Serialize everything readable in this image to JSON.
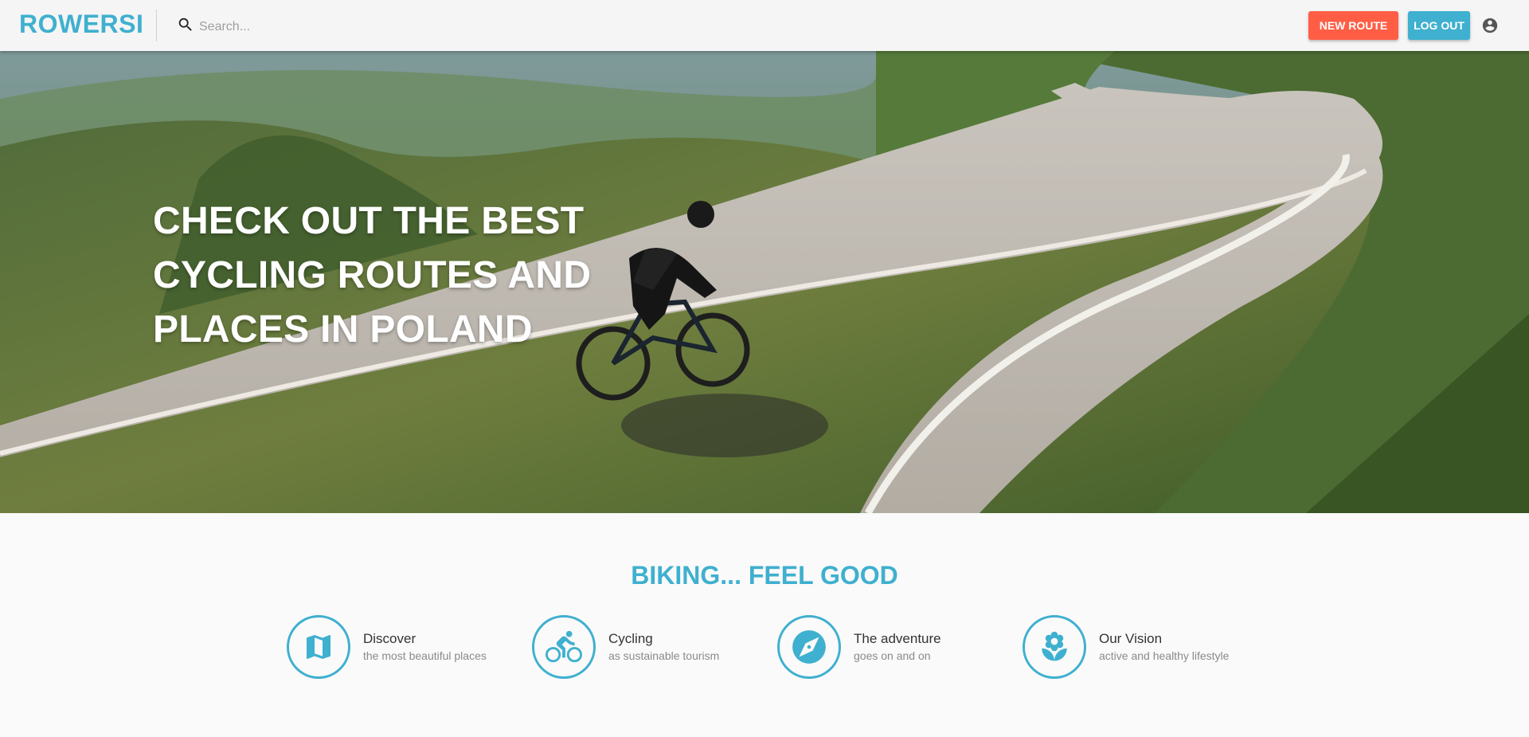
{
  "header": {
    "brand": "ROWERSI",
    "search_placeholder": "Search...",
    "new_route_label": "NEW ROUTE",
    "logout_label": "LOG OUT",
    "icons": [
      "search-icon",
      "account-circle-icon"
    ],
    "colors": {
      "brand": "#3fb0cf",
      "new_route": "#ff5e45",
      "logout": "#3fb0cf"
    }
  },
  "hero": {
    "title": "CHECK OUT THE BEST CYCLING ROUTES AND PLACES IN POLAND"
  },
  "features": {
    "title": "BIKING... FEEL GOOD",
    "items": [
      {
        "icon": "map-icon",
        "title": "Discover",
        "subtitle": "the most beautiful places"
      },
      {
        "icon": "bike-icon",
        "title": "Cycling",
        "subtitle": "as sustainable tourism"
      },
      {
        "icon": "compass-icon",
        "title": "The adventure",
        "subtitle": "goes on and on"
      },
      {
        "icon": "flower-icon",
        "title": "Our Vision",
        "subtitle": "active and healthy lifestyle"
      }
    ]
  }
}
